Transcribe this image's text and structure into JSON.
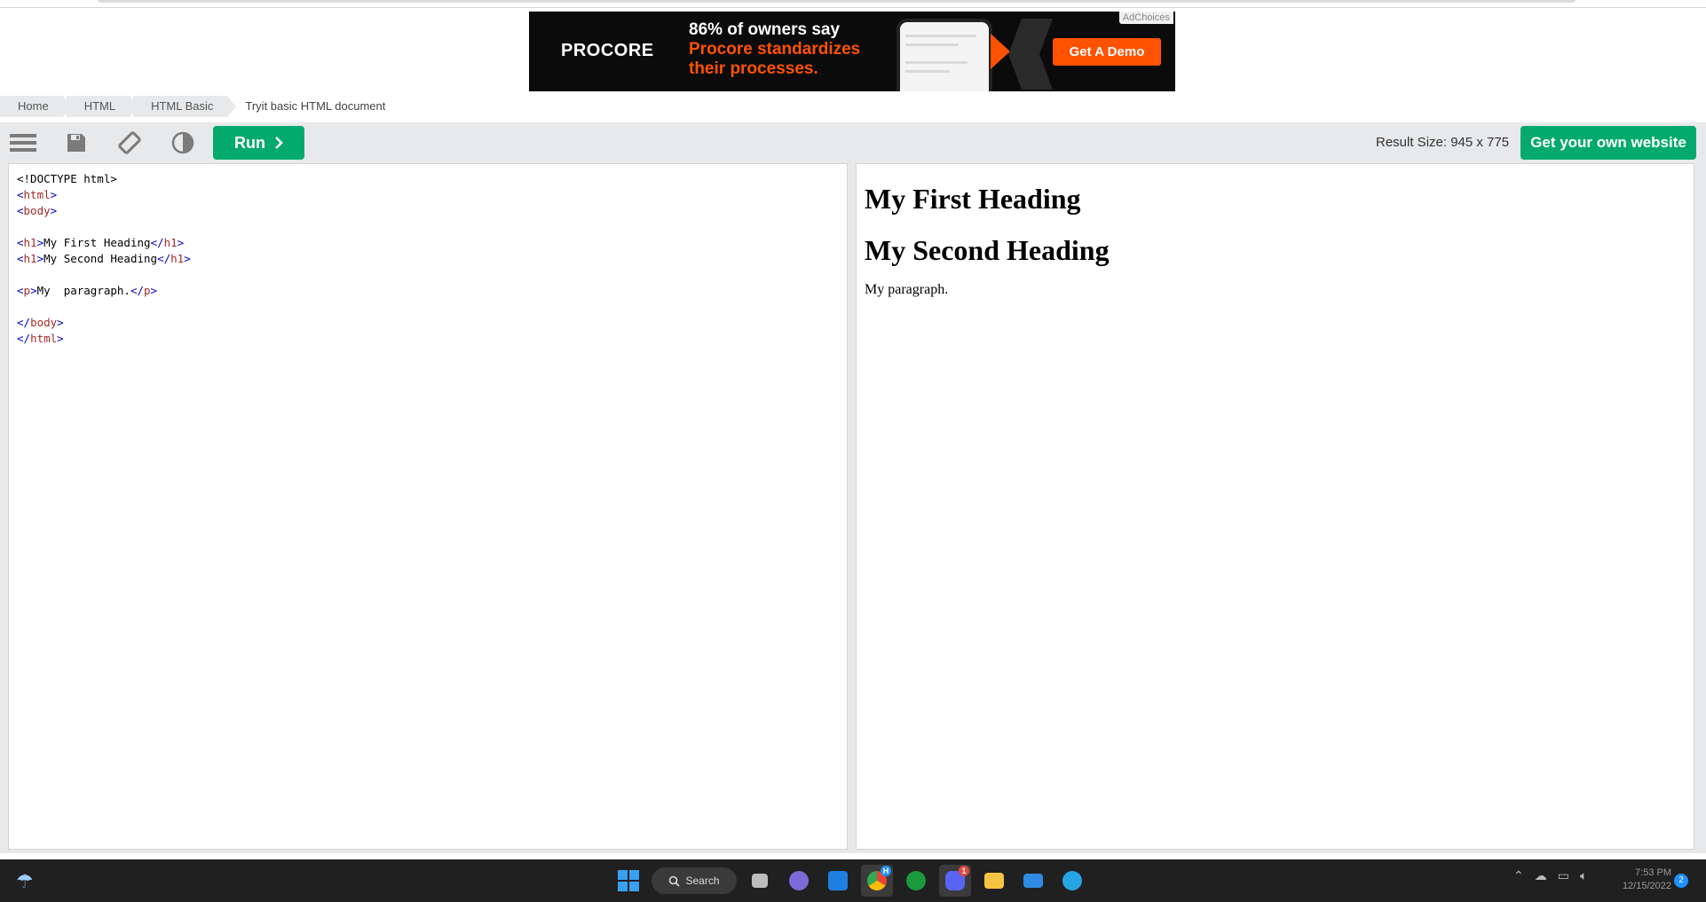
{
  "ad": {
    "brand": "PROCORE",
    "headline_line1": "86% of owners say",
    "headline_line2": "Procore standardizes their processes.",
    "cta": "Get A Demo",
    "adchoices": "AdChoices"
  },
  "breadcrumb": [
    "Home",
    "HTML",
    "HTML Basic",
    "Tryit basic HTML document"
  ],
  "toolbar": {
    "run_label": "Run",
    "result_size": "Result Size: 945 x 775",
    "own_site_label": "Get your own website"
  },
  "code_lines": [
    "<!DOCTYPE html>",
    "<html>",
    "<body>",
    "",
    "<h1>My First Heading</h1>",
    "<h1>My Second Heading</h1>",
    "",
    "<p>My  paragraph.</p>",
    "",
    "</body>",
    "</html>"
  ],
  "result": {
    "heading1": "My First Heading",
    "heading2": "My Second Heading",
    "paragraph": "My paragraph."
  },
  "taskbar": {
    "search_label": "Search",
    "weather_line1": "",
    "weather_line2": "",
    "time": "7:53 PM",
    "date": "12/15/2022",
    "chrome_badge": "H",
    "discord_badge": "1",
    "notification_count": "2"
  },
  "colors": {
    "accent_green": "#04aa6d",
    "toolbar_bg": "#e7e9eb",
    "ad_orange": "#ff5200"
  }
}
